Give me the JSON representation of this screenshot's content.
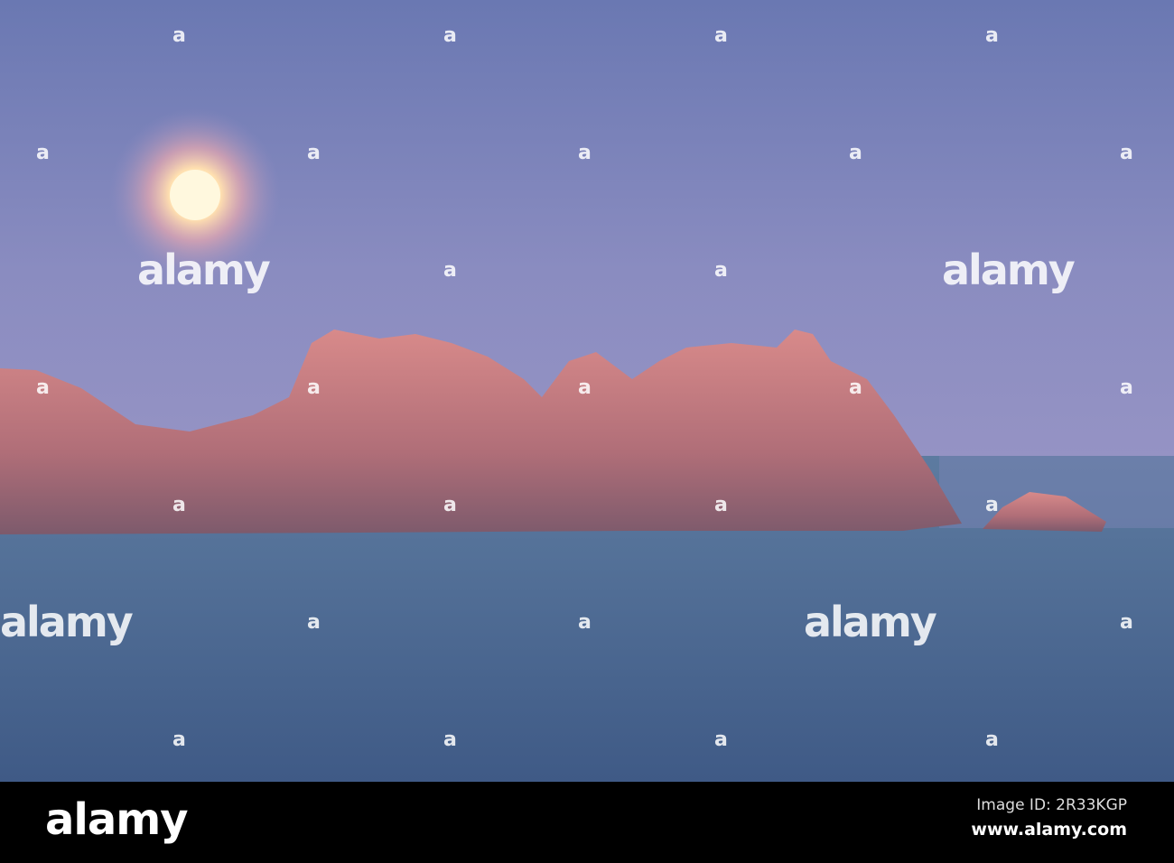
{
  "watermark": {
    "brand": "alamy"
  },
  "footer": {
    "logo": "alamy",
    "image_id": "Image ID: 2R33KGP",
    "url": "www.alamy.com"
  }
}
